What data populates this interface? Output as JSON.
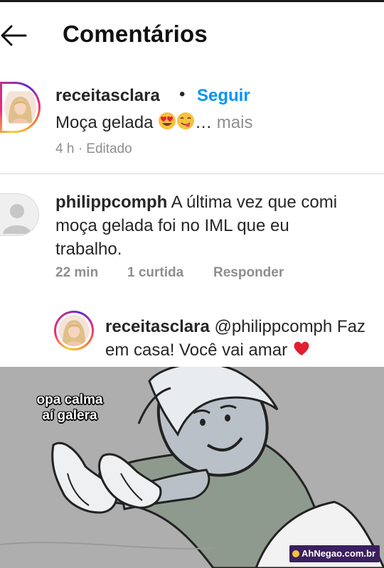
{
  "header": {
    "title": "Comentários"
  },
  "post": {
    "author": "receitasclara",
    "separator": "•",
    "follow_label": "Seguir",
    "caption_text": "Moça gelada",
    "more_ellipsis": "…",
    "more_label": "mais",
    "meta": "4 h · Editado",
    "emojis": [
      "heart-eyes-emoji",
      "yum-emoji"
    ]
  },
  "comment": {
    "author": "philippcomph",
    "text_line1": "A última vez que comi",
    "text_line2": "moça gelada foi no IML que eu",
    "text_line3": "trabalho.",
    "time": "22 min",
    "likes": "1 curtida",
    "reply_label": "Responder"
  },
  "reply": {
    "author": "receitasclara",
    "text_line1": "@philippcomph Faz",
    "text_line2": "em casa! Você vai amar",
    "emoji": "red-heart-emoji"
  },
  "meme": {
    "caption_line1": "opa calma",
    "caption_line2": "aí galera",
    "watermark": "AhNegao.com.br"
  },
  "colors": {
    "follow": "#0095f6",
    "meta": "#8e8e8e",
    "text": "#262626"
  }
}
